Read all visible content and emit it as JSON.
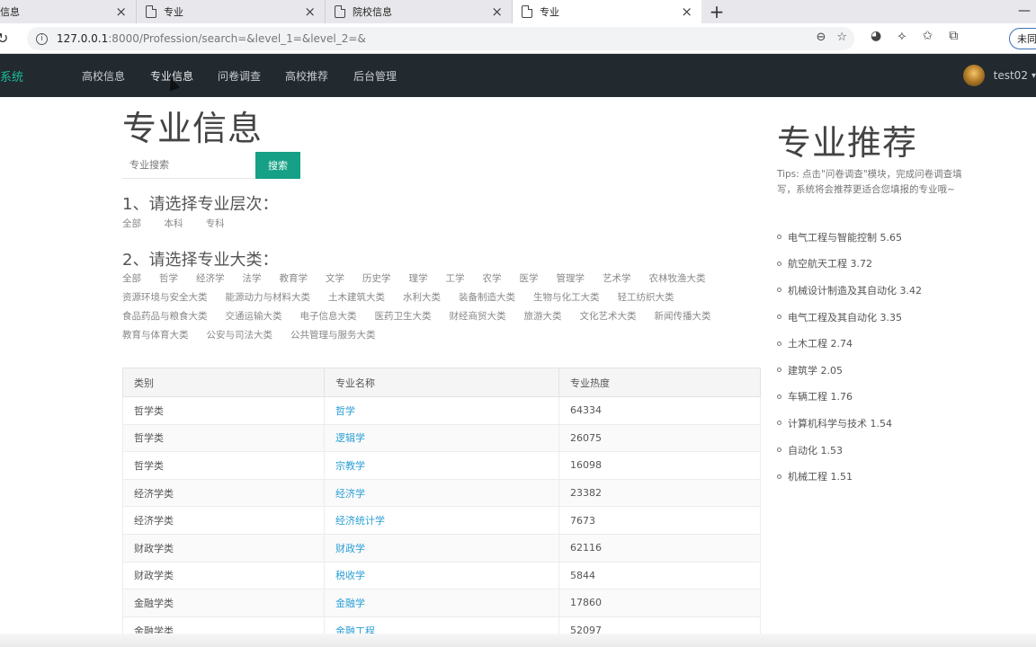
{
  "browser": {
    "tabs": [
      {
        "label": "信息",
        "active": false
      },
      {
        "label": "专业",
        "active": false
      },
      {
        "label": "院校信息",
        "active": false
      },
      {
        "label": "专业",
        "active": true
      }
    ],
    "new_tab": "+",
    "url_host": "127.0.0.1",
    "url_rest": ":8000/Profession/search=&level_1=&level_2=&",
    "profile_label": "未同",
    "icons": [
      "reload-icon",
      "info-icon",
      "zoom-icon",
      "favorite-add-icon",
      "extension-icon",
      "puzzle-icon",
      "favorites-icon",
      "collections-icon"
    ]
  },
  "navbar": {
    "brand": "系统",
    "items": [
      "高校信息",
      "专业信息",
      "问卷调查",
      "高校推荐",
      "后台管理"
    ],
    "username": "test02",
    "caret": "▾"
  },
  "main": {
    "title": "专业信息",
    "search_placeholder": "专业搜索",
    "search_button": "搜索",
    "level_heading": "1、请选择专业层次：",
    "levels": [
      "全部",
      "本科",
      "专科"
    ],
    "category_heading": "2、请选择专业大类：",
    "categories": [
      "全部",
      "哲学",
      "经济学",
      "法学",
      "教育学",
      "文学",
      "历史学",
      "理学",
      "工学",
      "农学",
      "医学",
      "管理学",
      "艺术学",
      "农林牧渔大类",
      "资源环境与安全大类",
      "能源动力与材料大类",
      "土木建筑大类",
      "水利大类",
      "装备制造大类",
      "生物与化工大类",
      "轻工纺织大类",
      "食品药品与粮食大类",
      "交通运输大类",
      "电子信息大类",
      "医药卫生大类",
      "财经商贸大类",
      "旅游大类",
      "文化艺术大类",
      "新闻传播大类",
      "教育与体育大类",
      "公安与司法大类",
      "公共管理与服务大类"
    ]
  },
  "table": {
    "headers": [
      "类别",
      "专业名称",
      "专业热度"
    ],
    "rows": [
      {
        "category": "哲学类",
        "name": "哲学",
        "heat": "64334"
      },
      {
        "category": "哲学类",
        "name": "逻辑学",
        "heat": "26075"
      },
      {
        "category": "哲学类",
        "name": "宗教学",
        "heat": "16098"
      },
      {
        "category": "经济学类",
        "name": "经济学",
        "heat": "23382"
      },
      {
        "category": "经济学类",
        "name": "经济统计学",
        "heat": "7673"
      },
      {
        "category": "财政学类",
        "name": "财政学",
        "heat": "62116"
      },
      {
        "category": "财政学类",
        "name": "税收学",
        "heat": "5844"
      },
      {
        "category": "金融学类",
        "name": "金融学",
        "heat": "17860"
      },
      {
        "category": "金融学类",
        "name": "金融工程",
        "heat": "52097"
      }
    ]
  },
  "recommend": {
    "title": "专业推荐",
    "tips": "Tips: 点击\"问卷调查\"模块，完成问卷调查填写，系统将会推荐更适合您填报的专业哦~",
    "items": [
      "电气工程与智能控制 5.65",
      "航空航天工程 3.72",
      "机械设计制造及其自动化 3.42",
      "电气工程及其自动化 3.35",
      "土木工程 2.74",
      "建筑学 2.05",
      "车辆工程 1.76",
      "计算机科学与技术 1.54",
      "自动化 1.53",
      "机械工程 1.51"
    ]
  }
}
